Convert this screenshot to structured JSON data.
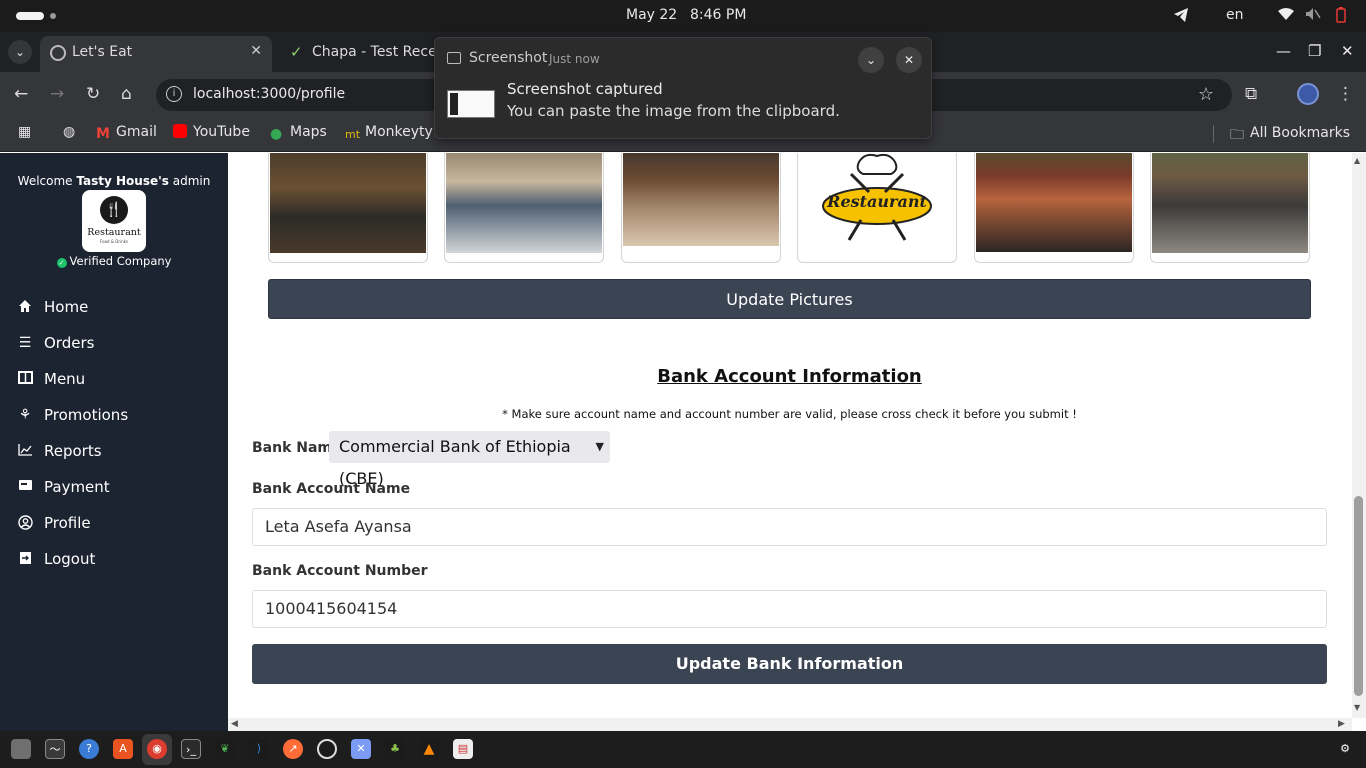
{
  "os": {
    "date": "May 22",
    "time": "8:46 PM",
    "language": "en"
  },
  "browser": {
    "tabs": [
      {
        "title": "Let's Eat"
      },
      {
        "title": "Chapa - Test Receip"
      }
    ],
    "url": "localhost:3000/profile",
    "bookmarks": [
      {
        "label": "Gmail"
      },
      {
        "label": "YouTube"
      },
      {
        "label": "Maps"
      },
      {
        "label": "Monkeyty"
      }
    ],
    "all_bookmarks": "All Bookmarks"
  },
  "notification": {
    "app": "Screenshot",
    "when": "Just now",
    "title": "Screenshot captured",
    "body": "You can paste the image from the clipboard."
  },
  "sidebar": {
    "welcome_prefix": "Welcome ",
    "company": "Tasty House's",
    "welcome_suffix": " admin",
    "logo_text": "Restaurant",
    "logo_subtext": "Food & Drinks",
    "verified": "Verified Company",
    "nav": [
      {
        "label": "Home",
        "icon": "home-icon"
      },
      {
        "label": "Orders",
        "icon": "list-icon"
      },
      {
        "label": "Menu",
        "icon": "menu-book-icon"
      },
      {
        "label": "Promotions",
        "icon": "promotion-icon"
      },
      {
        "label": "Reports",
        "icon": "chart-line-icon"
      },
      {
        "label": "Payment",
        "icon": "payment-icon"
      },
      {
        "label": "Profile",
        "icon": "profile-icon"
      },
      {
        "label": "Logout",
        "icon": "logout-icon"
      }
    ]
  },
  "main": {
    "pictures_logo_text": "Restaurant",
    "update_pictures": "Update Pictures",
    "bank_title": "Bank Account Information",
    "note": "* Make sure account name and account number are valid, please cross check it before you submit !",
    "bank_name_label": "Bank Name",
    "bank_name_value": "Commercial Bank of Ethiopia (CBE)",
    "account_name_label": "Bank Account Name",
    "account_name_value": "Leta Asefa Ayansa",
    "account_number_label": "Bank Account Number",
    "account_number_value": "1000415604154",
    "update_bank": "Update Bank Information"
  },
  "colors": {
    "sidebar_bg": "#1c2331",
    "button_bg": "#3b4453",
    "verified_green": "#1cc36b"
  }
}
